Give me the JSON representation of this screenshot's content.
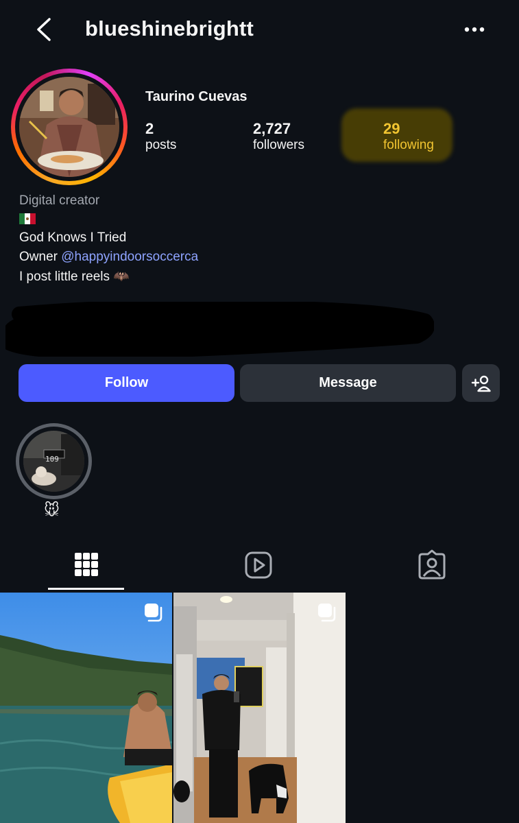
{
  "header": {
    "username": "blueshinebrightt",
    "back_icon": "chevron-left-icon",
    "more_icon": "more-horizontal-icon"
  },
  "profile": {
    "full_name": "Taurino Cuevas",
    "stats": {
      "posts": {
        "count": "2",
        "label": "posts"
      },
      "followers": {
        "count": "2,727",
        "label": "followers"
      },
      "following": {
        "count": "29",
        "label": "following"
      }
    },
    "category": "Digital creator",
    "flag_emoji": "🇲🇽",
    "bio_line_1": "God Knows I Tried",
    "bio_line_2_prefix": "Owner ",
    "bio_line_2_mention": "@happyindoorsoccerca",
    "bio_line_3": "I post little reels 🦇"
  },
  "actions": {
    "follow_label": "Follow",
    "message_label": "Message",
    "add_user_icon": "add-user-icon"
  },
  "highlights": [
    {
      "label": "🐭",
      "counter_text": "109"
    }
  ],
  "tabs": [
    {
      "name": "grid",
      "icon": "grid-icon",
      "active": true
    },
    {
      "name": "reels",
      "icon": "reels-icon",
      "active": false
    },
    {
      "name": "tagged",
      "icon": "tagged-icon",
      "active": false
    }
  ],
  "colors": {
    "background": "#0d1117",
    "follow_button": "#4c5bff",
    "secondary_button": "#2c3139",
    "mention": "#8ea3ff",
    "highlight_yellow": "#f2c531"
  }
}
